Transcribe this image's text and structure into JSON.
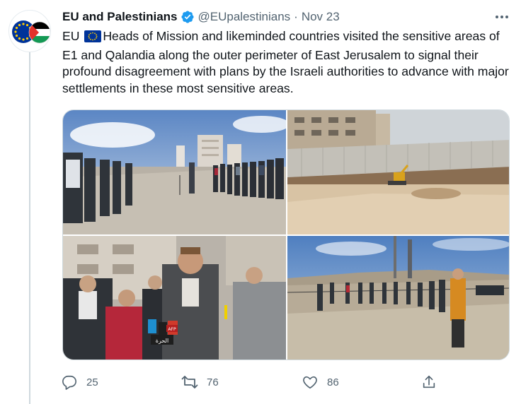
{
  "tweet": {
    "display_name": "EU and Palestinians",
    "handle": "@EUpalestinians",
    "separator": "·",
    "date": "Nov 23",
    "text_before_flag": "EU ",
    "text_after_flag": "Heads of Mission and likeminded countries visited the sensitive areas of E1 and Qalandia along the outer perimeter of East  Jerusalem to signal their profound disagreement with plans by the Israeli authorities to advance with major settlements in these most sensitive areas."
  },
  "media": {
    "photos": [
      {
        "icon": "photo-press-line"
      },
      {
        "icon": "photo-separation-wall"
      },
      {
        "icon": "photo-speaker-microphones",
        "mic_label_1": "الحرة",
        "mic_label_2": "AFP"
      },
      {
        "icon": "photo-group-hillside"
      }
    ]
  },
  "actions": {
    "reply_count": "25",
    "retweet_count": "76",
    "like_count": "86"
  },
  "icons": {
    "verified": "verified-badge-icon",
    "more": "more-icon",
    "reply": "reply-icon",
    "retweet": "retweet-icon",
    "like": "heart-icon",
    "share": "share-icon"
  },
  "colors": {
    "text": "#0f1419",
    "muted": "#536471",
    "verified": "#1d9bf0",
    "eu_blue": "#003399",
    "eu_gold": "#ffcc00"
  }
}
